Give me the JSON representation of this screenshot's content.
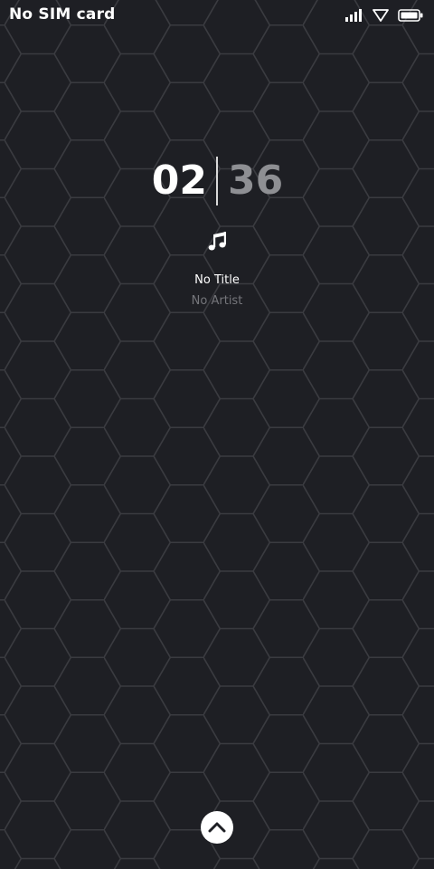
{
  "status_bar": {
    "carrier": "No SIM card",
    "icons": [
      "signal-icon",
      "wifi-icon",
      "battery-icon"
    ]
  },
  "clock": {
    "hours": "02",
    "minutes": "36"
  },
  "music": {
    "icon": "music-note-icon",
    "title": "No Title",
    "artist": "No Artist"
  },
  "unlock": {
    "icon": "chevron-up-icon"
  },
  "colors": {
    "background": "#1e1f24",
    "hex_line": "#3a3b40",
    "minutes": "#8e8f93",
    "artist": "#75767b"
  }
}
